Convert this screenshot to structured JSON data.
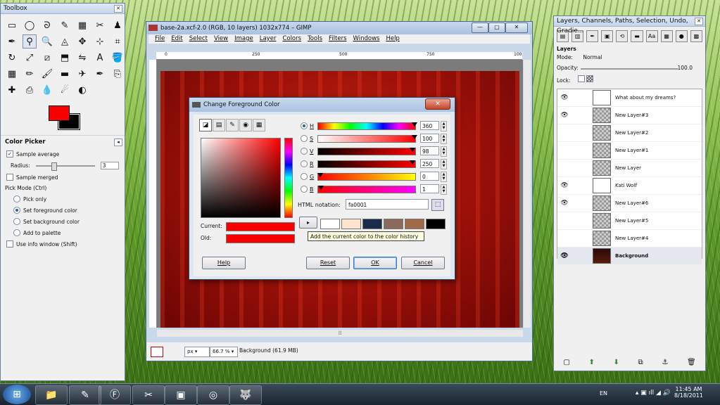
{
  "toolbox": {
    "title": "Toolbox",
    "tool_icons": [
      "rect-select-icon",
      "ellipse-select-icon",
      "lasso-icon",
      "fuzzy-select-icon",
      "by-color-select-icon",
      "scissors-icon",
      "foreground-select-icon",
      "paths-icon",
      "color-picker-icon",
      "zoom-icon",
      "measure-icon",
      "move-icon",
      "align-icon",
      "crop-icon",
      "rotate-icon",
      "scale-icon",
      "shear-icon",
      "perspective-icon",
      "flip-icon",
      "text-icon",
      "bucket-fill-icon",
      "blend-icon",
      "pencil-icon",
      "paintbrush-icon",
      "eraser-icon",
      "airbrush-icon",
      "ink-icon",
      "clone-icon",
      "heal-icon",
      "perspective-clone-icon",
      "blur-icon",
      "smudge-icon",
      "dodge-burn-icon"
    ],
    "tool_glyphs": [
      "▭",
      "◯",
      "ᘐ",
      "✎",
      "▦",
      "✂",
      "♟",
      "✒",
      "⚲",
      "🔍",
      "◬",
      "✥",
      "⊹",
      "⌗",
      "↻",
      "⤢",
      "⧄",
      "⬒",
      "⇋",
      "A",
      "🪣",
      "▦",
      "✏",
      "🖌",
      "▬",
      "✈",
      "✒",
      "⎘",
      "✚",
      "⎙",
      "💧",
      "☄",
      "◐"
    ],
    "fg_color": "#fa0001",
    "bg_color": "#000000",
    "options_title": "Color Picker",
    "sample_average": "Sample average",
    "radius_label": "Radius:",
    "radius_value": "3",
    "sample_merged": "Sample merged",
    "pick_mode_label": "Pick Mode  (Ctrl)",
    "pick_only": "Pick only",
    "set_fg": "Set foreground color",
    "set_bg": "Set background color",
    "add_palette": "Add to palette",
    "use_info": "Use info window  (Shift)"
  },
  "gimp": {
    "title": "base-2a.xcf-2.0 (RGB, 10 layers) 1032x774 – GIMP",
    "menu": [
      "File",
      "Edit",
      "Select",
      "View",
      "Image",
      "Layer",
      "Colors",
      "Tools",
      "Filters",
      "Windows",
      "Help"
    ],
    "ruler_ticks": [
      "0",
      "250",
      "500",
      "750",
      "100"
    ],
    "unit": "px",
    "zoom": "66.7 %",
    "status": "Background (61.9 MB)"
  },
  "dialog": {
    "title": "Change Foreground Color",
    "channels": [
      {
        "label": "H",
        "value": "360",
        "selected": true
      },
      {
        "label": "S",
        "value": "100",
        "selected": false
      },
      {
        "label": "V",
        "value": "98",
        "selected": false
      },
      {
        "label": "R",
        "value": "250",
        "selected": false
      },
      {
        "label": "G",
        "value": "0",
        "selected": false
      },
      {
        "label": "B",
        "value": "1",
        "selected": false
      }
    ],
    "html_label": "HTML notation:",
    "html_value": "fa0001",
    "current_label": "Current:",
    "old_label": "Old:",
    "current_color": "#fa0001",
    "history": [
      "#ffffff",
      "#fde3cc",
      "#1a2c4a",
      "#8a6a5a",
      "#a06a4a",
      "#000000"
    ],
    "tooltip": "Add the current color to the color history",
    "help": "Help",
    "reset": "Reset",
    "ok": "OK",
    "cancel": "Cancel"
  },
  "layers": {
    "title": "Layers, Channels, Paths, Selection, Undo, Gradie...",
    "section": "Layers",
    "mode_label": "Mode:",
    "mode_value": "Normal",
    "opacity_label": "Opacity:",
    "opacity_value": "100.0",
    "lock_label": "Lock:",
    "items": [
      {
        "name": "What about my dreams?",
        "visible": true,
        "thumb": "white"
      },
      {
        "name": "New Layer#3",
        "visible": true,
        "thumb": "checker"
      },
      {
        "name": "New Layer#2",
        "visible": false,
        "thumb": "checker"
      },
      {
        "name": "New Layer#1",
        "visible": false,
        "thumb": "checker"
      },
      {
        "name": "New Layer",
        "visible": false,
        "thumb": "checker"
      },
      {
        "name": "Kati Wolf",
        "visible": true,
        "thumb": "white"
      },
      {
        "name": "New Layer#6",
        "visible": true,
        "thumb": "checker"
      },
      {
        "name": "New Layer#5",
        "visible": false,
        "thumb": "checker"
      },
      {
        "name": "New Layer#4",
        "visible": false,
        "thumb": "checker"
      },
      {
        "name": "Background",
        "visible": true,
        "thumb": "bgimg",
        "selected": true
      }
    ]
  },
  "taskbar": {
    "lang": "EN",
    "time": "11:45 AM",
    "date": "8/18/2011"
  }
}
